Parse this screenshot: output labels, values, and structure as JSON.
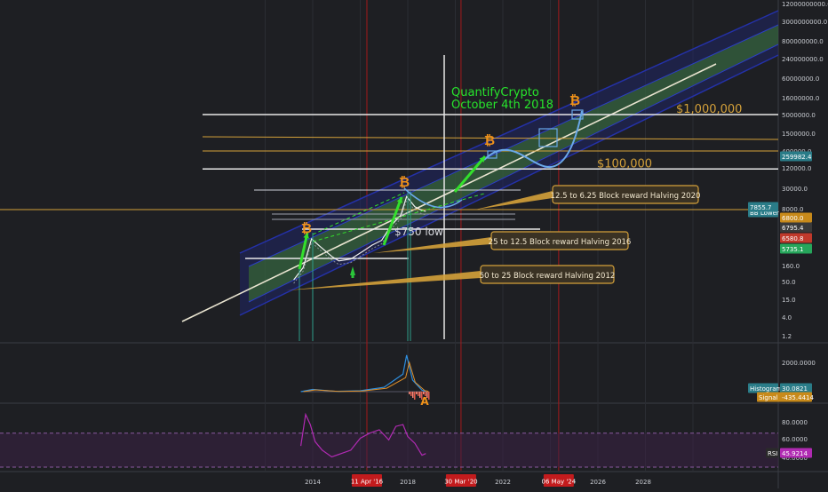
{
  "annotation_title": "QuantifyCrypto",
  "annotation_date": "October 4th 2018",
  "colors": {
    "background": "#1e1f23",
    "grid": "#2b2d33",
    "price_white": "#f2f2f2",
    "band_blue": "#2431a8",
    "band_green": "#3e7a2c",
    "gold": "#d4a13a",
    "projection": "#6aa8e8",
    "arrow_green": "#33e02c",
    "annotation_green": "#27e52c",
    "rsi_purple": "#b02ab2",
    "event_red": "#a3191b",
    "bitcoin_orange": "#f0921a"
  },
  "chart_data": [
    {
      "type": "line",
      "name": "price-panel",
      "y_scale": "log",
      "x_tick_labels": [
        "2014",
        "2018",
        "2022",
        "2026",
        "2028"
      ],
      "event_markers": [
        {
          "label": "11 Apr '16"
        },
        {
          "label": "30 Mar '20"
        },
        {
          "label": "06 May '24"
        }
      ],
      "y_axis_labels": [
        "12000000000.0",
        "3000000000.0",
        "800000000.0",
        "240000000.0",
        "60000000.0",
        "16000000.0",
        "5000000.0",
        "1500000.0",
        "400000.0",
        "120000.0",
        "30000.0",
        "8000.0",
        "160.0",
        "50.0",
        "15.0",
        "4.0",
        "1.2"
      ],
      "price_tags": [
        {
          "label": "259982.4",
          "color": "#2a7c88"
        },
        {
          "label": "BB Lower",
          "color": "#2a7c88"
        },
        {
          "label": "7855.7",
          "color": "#2a7c88"
        },
        {
          "label": "6800.0",
          "color": "#c88a1a"
        },
        {
          "label": "6795.4",
          "color": "#3a3a3a"
        },
        {
          "label": "6580.8",
          "color": "#c0392b"
        },
        {
          "label": "5735.1",
          "color": "#26a65b"
        }
      ],
      "level_labels": [
        {
          "text": "$1,000,000",
          "value": 5000000
        },
        {
          "text": "$100,000",
          "value": 120000
        }
      ],
      "halving_labels": [
        "12.5 to 6.25 Block reward Halving 2020",
        "25 to 12.5 Block reward Halving 2016",
        "50 to 25 Block reward Halving 2012"
      ],
      "low_label": "$750 low",
      "series": [
        {
          "name": "",
          "x": [
            2013.2,
            2013.6,
            2013.95,
            2014.3,
            2014.8,
            2015.1,
            2015.6,
            2016.1,
            2016.5,
            2016.9,
            2017.3,
            2017.7,
            2017.95,
            2018.3,
            2018.6,
            2018.76
          ],
          "y": [
            60,
            140,
            1000,
            600,
            300,
            220,
            250,
            420,
            650,
            900,
            2500,
            5000,
            18000,
            9000,
            7000,
            6600
          ]
        }
      ]
    },
    {
      "type": "line",
      "name": "macd-panel",
      "y_axis_labels": [
        "2000.0000"
      ],
      "tags": [
        {
          "label": "Histogram",
          "color": "#2a7c88"
        },
        {
          "label": "Signal",
          "color": "#c88a1a"
        },
        {
          "label": "30.0821",
          "color": "#2a7c88"
        },
        {
          "label": "-435.4414",
          "color": "#c88a1a"
        }
      ],
      "series": [
        {
          "name": "",
          "x": [
            2013.5,
            2014.0,
            2015.0,
            2016.0,
            2017.0,
            2017.8,
            2017.95,
            2018.2,
            2018.6,
            2018.76
          ],
          "y": [
            0,
            150,
            20,
            60,
            300,
            1200,
            2500,
            800,
            100,
            30
          ]
        }
      ]
    },
    {
      "type": "line",
      "name": "rsi-panel",
      "y_axis_labels": [
        "80.0000",
        "60.0000",
        "40.0000"
      ],
      "tags": [
        {
          "label": "RSI",
          "color": "#2a2a2a"
        },
        {
          "label": "45.9214",
          "color": "#b02ab2"
        }
      ],
      "series": [
        {
          "name": "",
          "x": [
            2013.5,
            2013.7,
            2013.9,
            2014.1,
            2014.4,
            2014.8,
            2015.2,
            2015.6,
            2016.0,
            2016.4,
            2016.8,
            2017.2,
            2017.5,
            2017.8,
            2018.0,
            2018.3,
            2018.6,
            2018.76
          ],
          "y": [
            55,
            92,
            80,
            60,
            50,
            42,
            46,
            50,
            64,
            70,
            74,
            62,
            78,
            80,
            66,
            58,
            44,
            46
          ]
        }
      ]
    }
  ]
}
